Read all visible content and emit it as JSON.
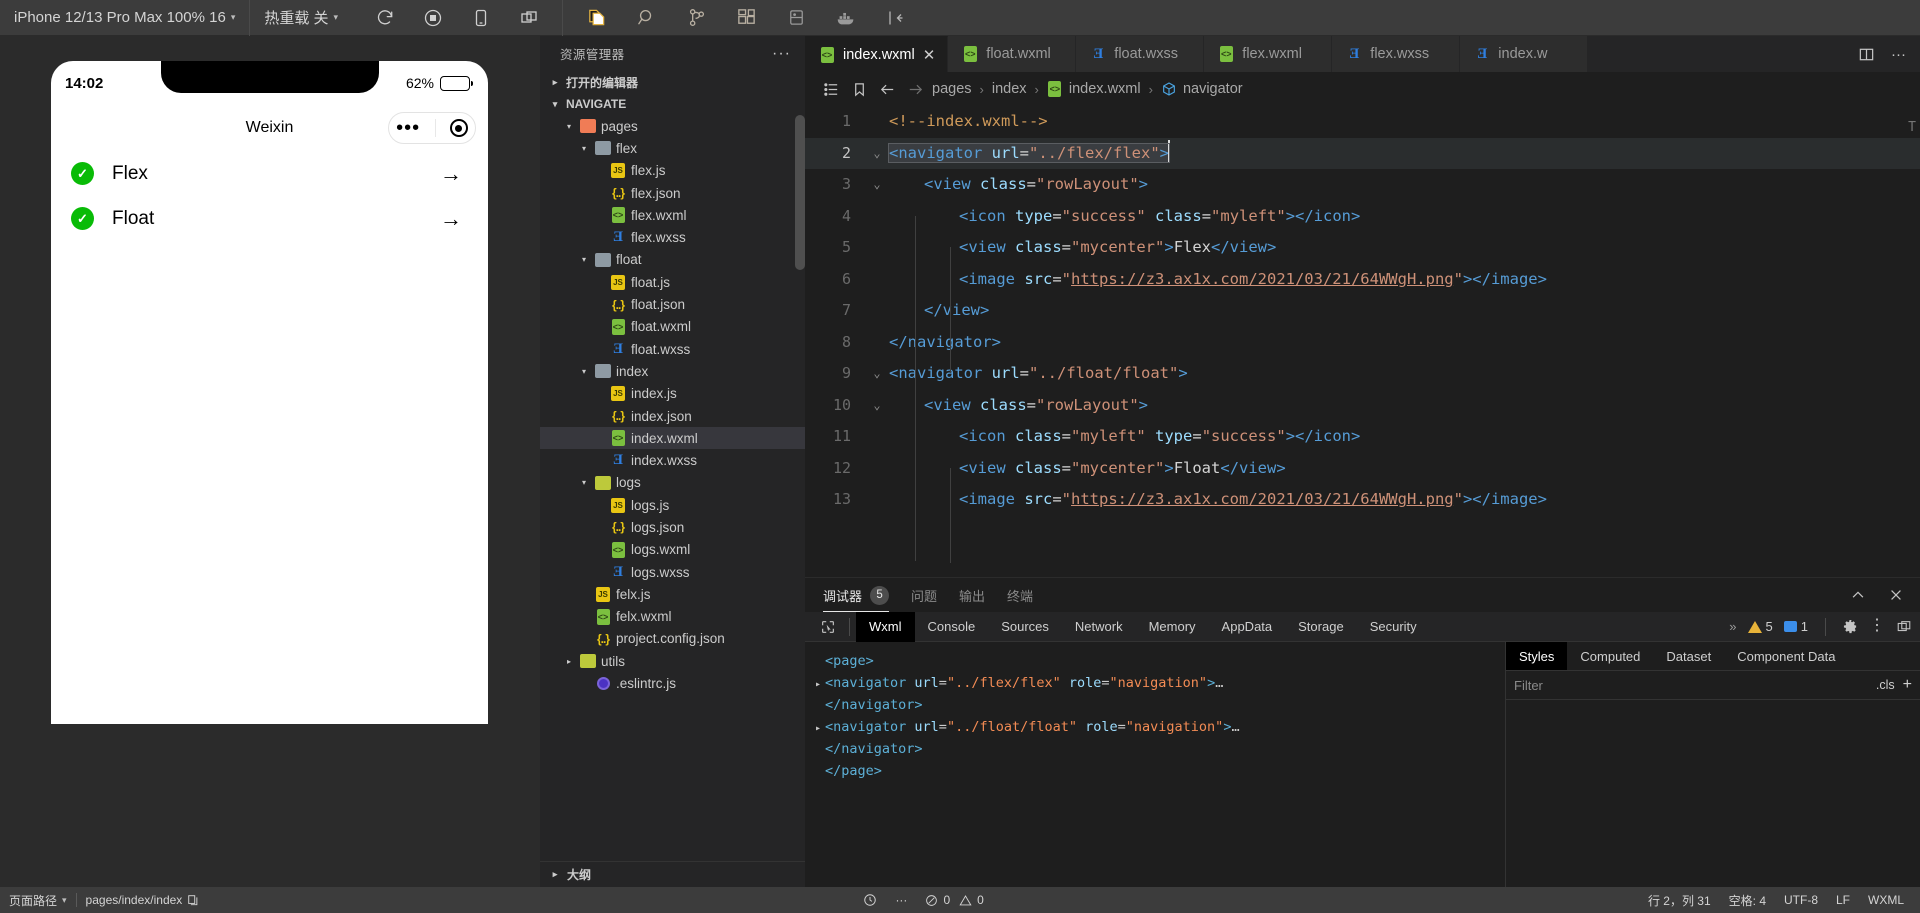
{
  "simulator_toolbar": {
    "device_select": "iPhone 12/13 Pro Max 100% 16",
    "hotreload_select": "热重载 关",
    "icons": [
      "refresh-icon",
      "record-icon",
      "phone-icon",
      "multi-window-icon"
    ]
  },
  "ide_toolbar": {
    "icons": [
      "copy-files-icon",
      "search-icon",
      "source-control-icon",
      "extensions-icon",
      "database-icon",
      "docker-icon",
      "collapse-panel-icon"
    ]
  },
  "phone": {
    "status_time": "14:02",
    "battery_text": "62%",
    "nav_title": "Weixin",
    "rows": [
      {
        "label": "Flex",
        "check": "✓",
        "arrow": "→"
      },
      {
        "label": "Float",
        "check": "✓",
        "arrow": "→"
      }
    ]
  },
  "explorer": {
    "title": "资源管理器",
    "more": "···",
    "open_editors": "打开的编辑器",
    "project": "NAVIGATE",
    "outline": "大纲",
    "tree": [
      {
        "label": "pages",
        "indent": 1,
        "icon": "folder-pages",
        "twisty": "▾",
        "selected": false
      },
      {
        "label": "flex",
        "indent": 2,
        "icon": "folder-plain",
        "twisty": "▾",
        "selected": false
      },
      {
        "label": "flex.js",
        "indent": 3,
        "icon": "js",
        "twisty": "",
        "selected": false
      },
      {
        "label": "flex.json",
        "indent": 3,
        "icon": "json",
        "twisty": "",
        "selected": false
      },
      {
        "label": "flex.wxml",
        "indent": 3,
        "icon": "wxml",
        "twisty": "",
        "selected": false
      },
      {
        "label": "flex.wxss",
        "indent": 3,
        "icon": "wxss",
        "twisty": "",
        "selected": false
      },
      {
        "label": "float",
        "indent": 2,
        "icon": "folder-plain",
        "twisty": "▾",
        "selected": false
      },
      {
        "label": "float.js",
        "indent": 3,
        "icon": "js",
        "twisty": "",
        "selected": false
      },
      {
        "label": "float.json",
        "indent": 3,
        "icon": "json",
        "twisty": "",
        "selected": false
      },
      {
        "label": "float.wxml",
        "indent": 3,
        "icon": "wxml",
        "twisty": "",
        "selected": false
      },
      {
        "label": "float.wxss",
        "indent": 3,
        "icon": "wxss",
        "twisty": "",
        "selected": false
      },
      {
        "label": "index",
        "indent": 2,
        "icon": "folder-plain",
        "twisty": "▾",
        "selected": false
      },
      {
        "label": "index.js",
        "indent": 3,
        "icon": "js",
        "twisty": "",
        "selected": false
      },
      {
        "label": "index.json",
        "indent": 3,
        "icon": "json",
        "twisty": "",
        "selected": false
      },
      {
        "label": "index.wxml",
        "indent": 3,
        "icon": "wxml",
        "twisty": "",
        "selected": true
      },
      {
        "label": "index.wxss",
        "indent": 3,
        "icon": "wxss",
        "twisty": "",
        "selected": false
      },
      {
        "label": "logs",
        "indent": 2,
        "icon": "folder-logs",
        "twisty": "▾",
        "selected": false
      },
      {
        "label": "logs.js",
        "indent": 3,
        "icon": "js",
        "twisty": "",
        "selected": false
      },
      {
        "label": "logs.json",
        "indent": 3,
        "icon": "json",
        "twisty": "",
        "selected": false
      },
      {
        "label": "logs.wxml",
        "indent": 3,
        "icon": "wxml",
        "twisty": "",
        "selected": false
      },
      {
        "label": "logs.wxss",
        "indent": 3,
        "icon": "wxss",
        "twisty": "",
        "selected": false
      },
      {
        "label": "felx.js",
        "indent": 2,
        "icon": "js",
        "twisty": "",
        "selected": false
      },
      {
        "label": "felx.wxml",
        "indent": 2,
        "icon": "wxml",
        "twisty": "",
        "selected": false
      },
      {
        "label": "project.config.json",
        "indent": 2,
        "icon": "json",
        "twisty": "",
        "selected": false
      },
      {
        "label": "utils",
        "indent": 1,
        "icon": "folder-logs",
        "twisty": "▸",
        "selected": false
      },
      {
        "label": ".eslintrc.js",
        "indent": 2,
        "icon": "eslint",
        "twisty": "",
        "selected": false
      }
    ]
  },
  "tabs": [
    {
      "label": "index.wxml",
      "icon": "wxml",
      "active": true,
      "close": "✕"
    },
    {
      "label": "float.wxml",
      "icon": "wxml",
      "active": false,
      "close": ""
    },
    {
      "label": "float.wxss",
      "icon": "wxss",
      "active": false,
      "close": ""
    },
    {
      "label": "flex.wxml",
      "icon": "wxml",
      "active": false,
      "close": ""
    },
    {
      "label": "flex.wxss",
      "icon": "wxss",
      "active": false,
      "close": ""
    },
    {
      "label": "index.w",
      "icon": "wxss",
      "active": false,
      "close": ""
    }
  ],
  "tabbar_actions": [
    "split-editor-icon",
    "more-actions-icon"
  ],
  "breadcrumb": {
    "icons": [
      "outline-icon",
      "bookmark-icon",
      "back-arrow-icon",
      "forward-arrow-icon"
    ],
    "items": [
      "pages",
      "index",
      "index.wxml",
      "navigator"
    ],
    "separator": "›"
  },
  "editor": {
    "minimap_hint": "T",
    "lines": [
      {
        "n": "1",
        "fold": "",
        "hl": false,
        "indent": 0,
        "parts": [
          {
            "t": "cmt",
            "v": "<!--index.wxml-->"
          }
        ]
      },
      {
        "n": "2",
        "fold": "⌄",
        "hl": true,
        "indent": 0,
        "parts": [
          {
            "t": "sel-tag",
            "v": "<navigator "
          },
          {
            "t": "sel-attr",
            "v": "url"
          },
          {
            "t": "sel-txt",
            "v": "="
          },
          {
            "t": "sel-str",
            "v": "\"../flex/flex\""
          },
          {
            "t": "sel-tag",
            "v": ">"
          },
          {
            "t": "caret",
            "v": ""
          }
        ]
      },
      {
        "n": "3",
        "fold": "⌄",
        "hl": false,
        "indent": 1,
        "parts": [
          {
            "t": "tag",
            "v": "<view "
          },
          {
            "t": "attr",
            "v": "class"
          },
          {
            "t": "txt",
            "v": "="
          },
          {
            "t": "str",
            "v": "\"rowLayout\""
          },
          {
            "t": "tag",
            "v": ">"
          }
        ]
      },
      {
        "n": "4",
        "fold": "",
        "hl": false,
        "indent": 2,
        "parts": [
          {
            "t": "tag",
            "v": "<icon "
          },
          {
            "t": "attr",
            "v": "type"
          },
          {
            "t": "txt",
            "v": "="
          },
          {
            "t": "str",
            "v": "\"success\""
          },
          {
            "t": "txt",
            "v": " "
          },
          {
            "t": "attr",
            "v": "class"
          },
          {
            "t": "txt",
            "v": "="
          },
          {
            "t": "str",
            "v": "\"myleft\""
          },
          {
            "t": "tag",
            "v": "></icon>"
          }
        ]
      },
      {
        "n": "5",
        "fold": "",
        "hl": false,
        "indent": 2,
        "parts": [
          {
            "t": "tag",
            "v": "<view "
          },
          {
            "t": "attr",
            "v": "class"
          },
          {
            "t": "txt",
            "v": "="
          },
          {
            "t": "str",
            "v": "\"mycenter\""
          },
          {
            "t": "tag",
            "v": ">"
          },
          {
            "t": "txt",
            "v": "Flex"
          },
          {
            "t": "tag",
            "v": "</view>"
          }
        ]
      },
      {
        "n": "6",
        "fold": "",
        "hl": false,
        "indent": 2,
        "parts": [
          {
            "t": "tag",
            "v": "<image "
          },
          {
            "t": "attr",
            "v": "src"
          },
          {
            "t": "txt",
            "v": "="
          },
          {
            "t": "str",
            "v": "\""
          },
          {
            "t": "link",
            "v": "https://z3.ax1x.com/2021/03/21/64WWgH.png"
          },
          {
            "t": "str",
            "v": "\""
          },
          {
            "t": "tag",
            "v": "></image>"
          }
        ]
      },
      {
        "n": "7",
        "fold": "",
        "hl": false,
        "indent": 1,
        "parts": [
          {
            "t": "tag",
            "v": "</view>"
          }
        ]
      },
      {
        "n": "8",
        "fold": "",
        "hl": false,
        "indent": 0,
        "parts": [
          {
            "t": "tag",
            "v": "</navigator>"
          }
        ]
      },
      {
        "n": "9",
        "fold": "⌄",
        "hl": false,
        "indent": 0,
        "parts": [
          {
            "t": "tag",
            "v": "<navigator "
          },
          {
            "t": "attr",
            "v": "url"
          },
          {
            "t": "txt",
            "v": "="
          },
          {
            "t": "str",
            "v": "\"../float/float\""
          },
          {
            "t": "tag",
            "v": ">"
          }
        ]
      },
      {
        "n": "10",
        "fold": "⌄",
        "hl": false,
        "indent": 1,
        "parts": [
          {
            "t": "tag",
            "v": "<view "
          },
          {
            "t": "attr",
            "v": "class"
          },
          {
            "t": "txt",
            "v": "="
          },
          {
            "t": "str",
            "v": "\"rowLayout\""
          },
          {
            "t": "tag",
            "v": ">"
          }
        ]
      },
      {
        "n": "11",
        "fold": "",
        "hl": false,
        "indent": 2,
        "parts": [
          {
            "t": "tag",
            "v": "<icon "
          },
          {
            "t": "attr",
            "v": "class"
          },
          {
            "t": "txt",
            "v": "="
          },
          {
            "t": "str",
            "v": "\"myleft\""
          },
          {
            "t": "txt",
            "v": " "
          },
          {
            "t": "attr",
            "v": "type"
          },
          {
            "t": "txt",
            "v": "="
          },
          {
            "t": "str",
            "v": "\"success\""
          },
          {
            "t": "tag",
            "v": "></icon>"
          }
        ]
      },
      {
        "n": "12",
        "fold": "",
        "hl": false,
        "indent": 2,
        "parts": [
          {
            "t": "tag",
            "v": "<view "
          },
          {
            "t": "attr",
            "v": "class"
          },
          {
            "t": "txt",
            "v": "="
          },
          {
            "t": "str",
            "v": "\"mycenter\""
          },
          {
            "t": "tag",
            "v": ">"
          },
          {
            "t": "txt",
            "v": "Float"
          },
          {
            "t": "tag",
            "v": "</view>"
          }
        ]
      },
      {
        "n": "13",
        "fold": "",
        "hl": false,
        "indent": 2,
        "parts": [
          {
            "t": "tag",
            "v": "<image "
          },
          {
            "t": "attr",
            "v": "src"
          },
          {
            "t": "txt",
            "v": "="
          },
          {
            "t": "str",
            "v": "\""
          },
          {
            "t": "link",
            "v": "https://z3.ax1x.com/2021/03/21/64WWgH.png"
          },
          {
            "t": "str",
            "v": "\""
          },
          {
            "t": "tag",
            "v": "></image>"
          }
        ]
      }
    ]
  },
  "panel": {
    "tabs": [
      {
        "label": "调试器",
        "badge": "5",
        "active": true
      },
      {
        "label": "问题",
        "badge": "",
        "active": false
      },
      {
        "label": "输出",
        "badge": "",
        "active": false
      },
      {
        "label": "终端",
        "badge": "",
        "active": false
      }
    ],
    "actions": [
      "chevron-up-icon",
      "close-icon"
    ]
  },
  "devtools": {
    "tabs": [
      "Wxml",
      "Console",
      "Sources",
      "Network",
      "Memory",
      "AppData",
      "Storage",
      "Security"
    ],
    "active_tab": "Wxml",
    "overflow": "»",
    "warning_count": "5",
    "message_count": "1",
    "right_icons": [
      "gear-icon",
      "kebab-menu-icon",
      "dock-icon"
    ],
    "dom_lines": [
      {
        "arrow": "",
        "indent": 0,
        "parts": [
          {
            "t": "tag",
            "v": "<page>"
          }
        ]
      },
      {
        "arrow": "▸",
        "indent": 0,
        "parts": [
          {
            "t": "tag",
            "v": "<navigator "
          },
          {
            "t": "attr",
            "v": "url"
          },
          {
            "t": "txt",
            "v": "="
          },
          {
            "t": "val",
            "v": "\"../flex/flex\""
          },
          {
            "t": "txt",
            "v": " "
          },
          {
            "t": "attr",
            "v": "role"
          },
          {
            "t": "txt",
            "v": "="
          },
          {
            "t": "val",
            "v": "\"navigation\""
          },
          {
            "t": "tag",
            "v": ">"
          },
          {
            "t": "txt",
            "v": "…"
          }
        ]
      },
      {
        "arrow": "",
        "indent": 0,
        "parts": [
          {
            "t": "tag",
            "v": "</navigator>"
          }
        ]
      },
      {
        "arrow": "▸",
        "indent": 0,
        "parts": [
          {
            "t": "tag",
            "v": "<navigator "
          },
          {
            "t": "attr",
            "v": "url"
          },
          {
            "t": "txt",
            "v": "="
          },
          {
            "t": "val",
            "v": "\"../float/float\""
          },
          {
            "t": "txt",
            "v": " "
          },
          {
            "t": "attr",
            "v": "role"
          },
          {
            "t": "txt",
            "v": "="
          },
          {
            "t": "val",
            "v": "\"navigation\""
          },
          {
            "t": "tag",
            "v": ">"
          },
          {
            "t": "txt",
            "v": "…"
          }
        ]
      },
      {
        "arrow": "",
        "indent": 0,
        "parts": [
          {
            "t": "tag",
            "v": "</navigator>"
          }
        ]
      },
      {
        "arrow": "",
        "indent": 0,
        "parts": [
          {
            "t": "tag",
            "v": "</page>"
          }
        ]
      }
    ],
    "styles_tabs": [
      "Styles",
      "Computed",
      "Dataset",
      "Component Data"
    ],
    "styles_active": "Styles",
    "filter_placeholder": "Filter",
    "cls_label": ".cls",
    "plus_label": "+"
  },
  "statusbar": {
    "page_path_label": "页面路径",
    "page_path_value": "pages/index/index",
    "copy_icon": "copy-icon",
    "clock_icon": "clock-icon",
    "more_icon": "···",
    "errors": "0",
    "warnings": "0",
    "cursor": "行 2，列 31",
    "indent": "空格: 4",
    "encoding": "UTF-8",
    "eol": "LF",
    "language": "WXML"
  },
  "colors": {
    "accent_green": "#09bb07",
    "tag_blue": "#569cd6",
    "attr_blue": "#9cdcfe",
    "string_orange": "#ce9178",
    "comment_gold": "#cf9a5a"
  }
}
